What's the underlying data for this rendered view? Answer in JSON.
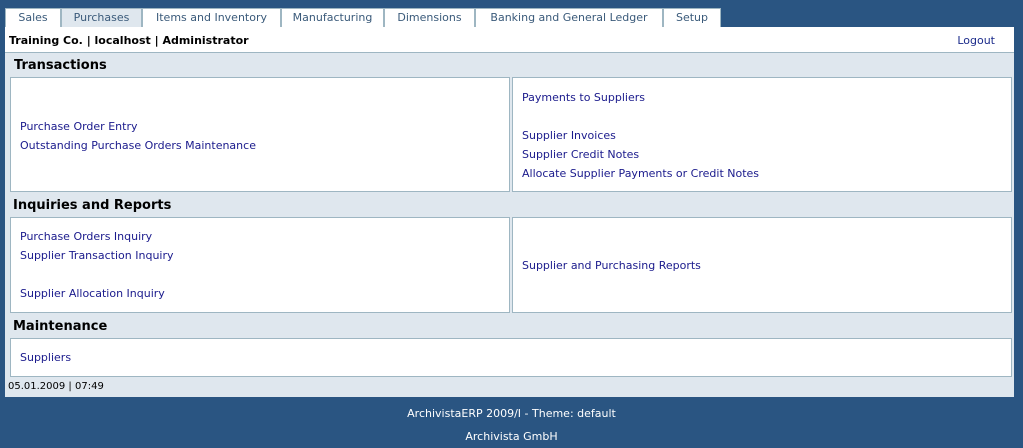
{
  "tabs": [
    "Sales",
    "Purchases",
    "Items and Inventory",
    "Manufacturing",
    "Dimensions",
    "Banking and General Ledger",
    "Setup"
  ],
  "header": {
    "company_info": "Training Co. | localhost | Administrator",
    "logout": "Logout"
  },
  "sections": {
    "transactions": {
      "title": "Transactions",
      "left": [
        "Purchase Order Entry",
        "Outstanding Purchase Orders Maintenance"
      ],
      "right": [
        "Payments to Suppliers",
        "Supplier Invoices",
        "Supplier Credit Notes",
        "Allocate Supplier Payments or Credit Notes"
      ]
    },
    "inquiries": {
      "title": "Inquiries and Reports",
      "left": [
        "Purchase Orders Inquiry",
        "Supplier Transaction Inquiry",
        "Supplier Allocation Inquiry"
      ],
      "right": [
        "Supplier and Purchasing Reports"
      ]
    },
    "maintenance": {
      "title": "Maintenance",
      "left": [
        "Suppliers"
      ]
    }
  },
  "status": "05.01.2009 | 07:49",
  "footer": {
    "line1": "ArchivistaERP 2009/I - Theme: default",
    "line2": "Archivista GmbH"
  }
}
